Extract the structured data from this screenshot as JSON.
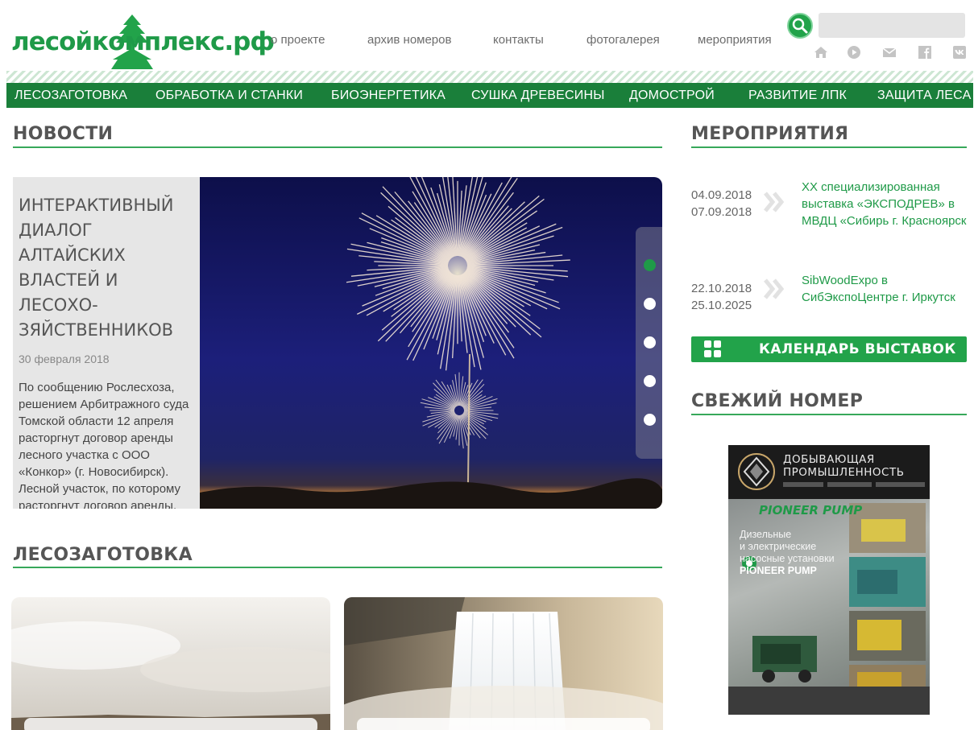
{
  "header": {
    "logo_text": "лесойкомплекс.рф",
    "top_nav": [
      "о проекте",
      "архив номеров",
      "контакты",
      "фотогалерея",
      "мероприятия"
    ],
    "search": {
      "value": "",
      "placeholder": ""
    },
    "social_icons": [
      "home-icon",
      "youtube-icon",
      "mail-icon",
      "facebook-icon",
      "vk-icon"
    ]
  },
  "category_nav": [
    "ЛЕСОЗАГОТОВКА",
    "ОБРАБОТКА И СТАНКИ",
    "БИОЭНЕРГЕТИКА",
    "СУШКА ДРЕВЕСИНЫ",
    "ДОМОСТРОЙ",
    "РАЗВИТИЕ ЛПК",
    "ЗАЩИТА ЛЕСА"
  ],
  "news": {
    "section_title": "НОВОСТИ",
    "featured": {
      "title": "ИНТЕРАКТИВНЫЙ ДИАЛОГ АЛТАЙСКИХ ВЛАСТЕЙ И ЛЕСОХО-ЗЯЙСТВЕННИКОВ",
      "date": "30 февраля 2018",
      "body": "По сообщению Рослесхоза, решением Арбитражного суда Томской области 12 апреля расторгнут договор аренды лесного участка с ООО «Конкор» (г. Новосибирск). Лесной участок, по которому расторгнут договор аренды, расположен на территории Чаинского лесничества..."
    },
    "slider_dots": 5,
    "active_dot": 1
  },
  "logging": {
    "section_title": "ЛЕСОЗАГОТОВКА"
  },
  "events": {
    "section_title": "МЕРОПРИЯТИЯ",
    "items": [
      {
        "date_start": "04.09.2018",
        "date_end": "07.09.2018",
        "title": "XX специализированная выставка «ЭКСПОДРЕВ» в МВДЦ «Сибирь г. Красноярск"
      },
      {
        "date_start": "22.10.2018",
        "date_end": "25.10.2025",
        "title": "SibWoodExpo в СибЭкспоЦентре г. Иркутск"
      }
    ],
    "calendar_button": "КАЛЕНДАРЬ ВЫСТАВОК"
  },
  "latest_issue": {
    "section_title": "СВЕЖИЙ НОМЕР",
    "cover": {
      "magazine_title": "ДОБЫВАЮЩАЯ ПРОМЫШЛЕННОСТЬ",
      "ad_brand": "PIONEER PUMP",
      "ad_headline_1": "Дизельные",
      "ad_headline_2": "и электрические",
      "ad_headline_3": "насосные установки",
      "ad_headline_4": "PIONEER PUMP"
    }
  },
  "colors": {
    "brand_green": "#1f9a48",
    "nav_green": "#1a7f3a",
    "button_green": "#22a34a",
    "heading_gray": "#555555"
  }
}
